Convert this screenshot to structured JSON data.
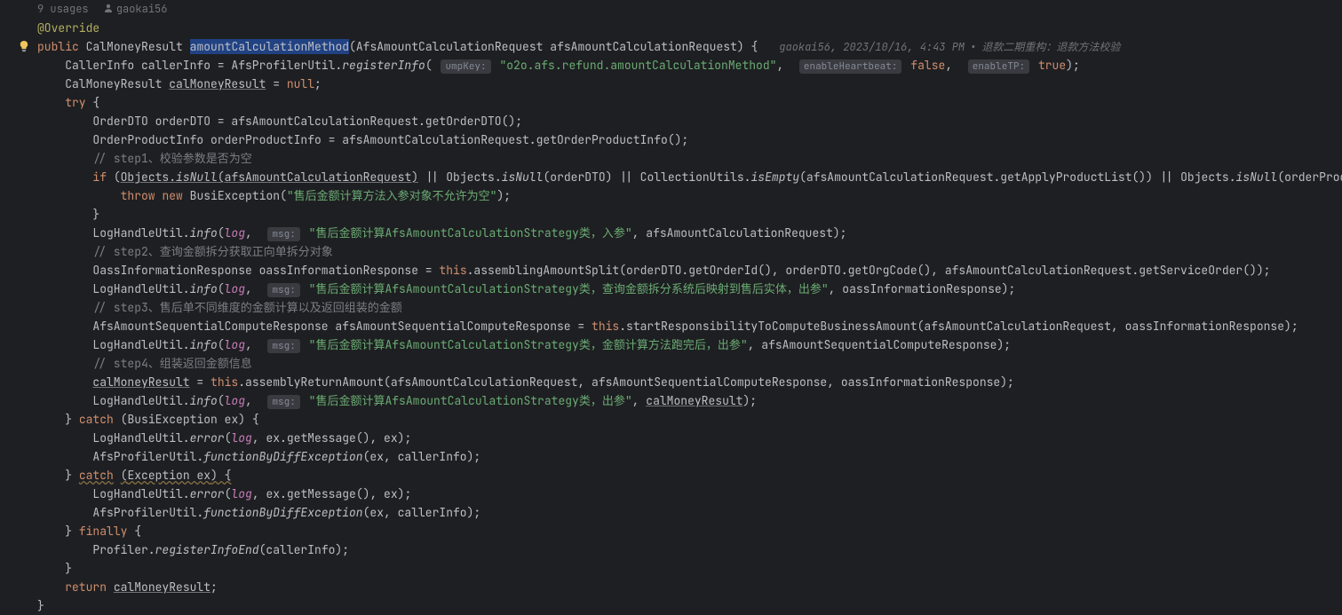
{
  "meta": {
    "usages": "9 usages",
    "author": "gaokai56"
  },
  "inlay": {
    "author_date": "gaokai56, 2023/10/16, 4:43 PM",
    "commit_msg": "退款二期重构：退款方法校验"
  },
  "hints": {
    "umpKey": "umpKey:",
    "enableHeartbeat": "enableHeartbeat:",
    "enableTP": "enableTP:",
    "msg": "msg:"
  },
  "code": {
    "annotation": "@Override",
    "kw_public": "public",
    "type_CalMoneyResult": "CalMoneyResult",
    "method_name": "amountCalculationMethod",
    "param_type": "AfsAmountCalculationRequest",
    "param_name": "afsAmountCalculationRequest",
    "callerInfo_decl": "CallerInfo callerInfo = AfsProfilerUtil.",
    "registerInfo": "registerInfo",
    "str_ump": "\"o2o.afs.refund.amountCalculationMethod\"",
    "kw_false": "false",
    "kw_true": "true",
    "calMoneyResult_decl_l": "CalMoneyResult ",
    "calMoneyResult_var": "calMoneyResult",
    "calMoneyResult_decl_r": " = ",
    "kw_null": "null",
    "kw_try": "try",
    "orderDTO_line": "OrderDTO orderDTO = afsAmountCalculationRequest.getOrderDTO();",
    "orderProductInfo_line": "OrderProductInfo orderProductInfo = afsAmountCalculationRequest.getOrderProductInfo();",
    "c_step1": "// step1、校验参数是否为空",
    "kw_if": "if",
    "objects_isNull1": "Objects.",
    "isNull": "isNull",
    "isNull_arg1": "(afsAmountCalculationRequest)",
    "or1": " || Objects.",
    "isNull_arg2": "(orderDTO)",
    "or2": " || CollectionUtils.",
    "isEmpty": "isEmpty",
    "isEmpty_arg": "(afsAmountCalculationRequest.getApplyProductList())",
    "or3": " || Objects.",
    "isNull_arg3": "(orderProductInfo)) {",
    "kw_throw": "throw",
    "kw_new": "new",
    "busiEx": "BusiException",
    "str_throw": "\"售后金额计算方法入参对象不允许为空\"",
    "logInfo": "LogHandleUtil.",
    "info": "info",
    "log": "log",
    "str_log1": "\"售后金额计算AfsAmountCalculationStrategy类，入参\"",
    "log1_args": ", afsAmountCalculationRequest);",
    "c_step2": "// step2、查询金额拆分获取正向单拆分对象",
    "oass_line_l": "OassInformationResponse oassInformationResponse = ",
    "kw_this": "this",
    "oass_line_r": ".assemblingAmountSplit(orderDTO.getOrderId(), orderDTO.getOrgCode(), afsAmountCalculationRequest.getServiceOrder());",
    "str_log2": "\"售后金额计算AfsAmountCalculationStrategy类，查询金额拆分系统后映射到售后实体，出参\"",
    "log2_args": ", oassInformationResponse);",
    "c_step3": "// step3、售后单不同维度的金额计算以及返回组装的金额",
    "afsSeq_line_l": "AfsAmountSequentialComputeResponse afsAmountSequentialComputeResponse = ",
    "afsSeq_line_r": ".startResponsibilityToComputeBusinessAmount(afsAmountCalculationRequest, oassInformationResponse);",
    "str_log3": "\"售后金额计算AfsAmountCalculationStrategy类，金额计算方法跑完后，出参\"",
    "log3_args": ", afsAmountSequentialComputeResponse);",
    "c_step4": "// step4、组装返回金额信息",
    "assembly_line_l_var": "calMoneyResult",
    "assembly_line_eq": " = ",
    "assembly_line_r": ".assemblyReturnAmount(afsAmountCalculationRequest, afsAmountSequentialComputeResponse, oassInformationResponse);",
    "str_log4": "\"售后金额计算AfsAmountCalculationStrategy类，出参\"",
    "log4_var": "calMoneyResult",
    "kw_catch": "catch",
    "catch1_param": "(BusiException ex) {",
    "error": "error",
    "error_args": ", ex.getMessage(), ex);",
    "funcByDiff": "functionByDiffException",
    "funcByDiff_args": "(ex, callerInfo);",
    "catch2_param_l": "(",
    "catch2_param_mid": "Exception ex",
    "catch2_param_r": ") {",
    "kw_finally": "finally",
    "profiler_line_l": "Profiler.",
    "registerInfoEnd": "registerInfoEnd",
    "profiler_line_r": "(callerInfo);",
    "kw_return": "return",
    "return_var": "calMoneyResult"
  }
}
